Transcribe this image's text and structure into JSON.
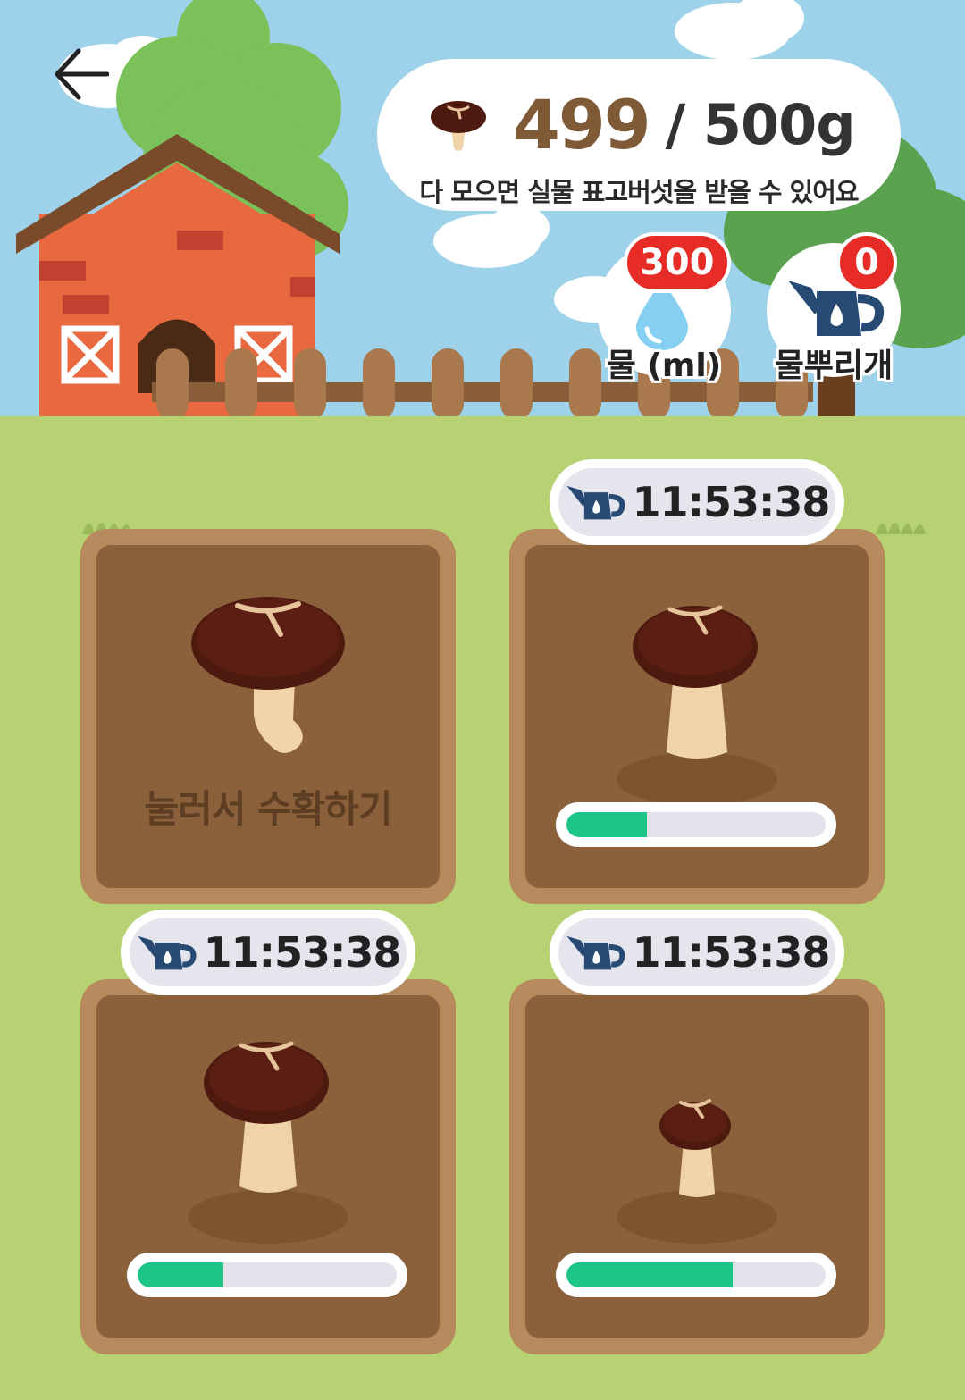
{
  "header": {
    "collected": "499",
    "goal": "/ 500g",
    "subtitle": "다 모으면 실물 표고버섯을 받을 수 있어요"
  },
  "resources": [
    {
      "badge": "300",
      "label": "물 (ml)",
      "icon": "water-drop-icon"
    },
    {
      "badge": "0",
      "label": "물뿌리개",
      "icon": "watering-can-icon"
    }
  ],
  "plots": [
    {
      "state": "ready",
      "harvest_label": "눌러서 수확하기"
    },
    {
      "state": "growing",
      "timer": "11:53:38",
      "progress": 0.31
    },
    {
      "state": "growing",
      "timer": "11:53:38",
      "progress": 0.33
    },
    {
      "state": "growing",
      "timer": "11:53:38",
      "progress": 0.64
    }
  ],
  "colors": {
    "sky": "#9dd2ea",
    "grass": "#b7d272",
    "soil": "#8b613c",
    "progress": "#1fc489",
    "badge": "#e72b26"
  }
}
